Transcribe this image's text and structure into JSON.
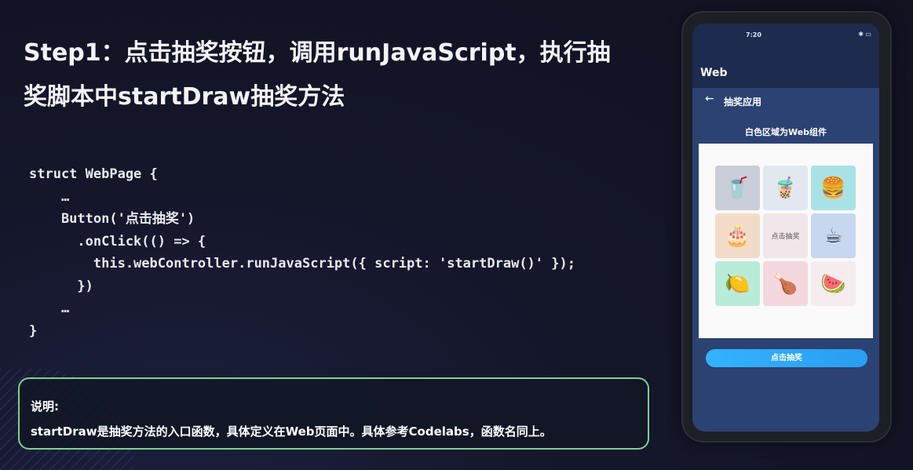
{
  "slide": {
    "title_line1": "Step1：点击抽奖按钮，调用runJavaScript，执行抽",
    "title_line2": "奖脚本中startDraw抽奖方法",
    "code_lines": [
      "struct WebPage {",
      "    …",
      "    Button('点击抽奖')",
      "      .onClick(() => {",
      "        this.webController.runJavaScript({ script: 'startDraw()' });",
      "      })",
      "    …",
      "}"
    ],
    "note_title": "说明:",
    "note_text": "startDraw是抽奖方法的入口函数，具体定义在Web页面中。具体参考Codelabs，函数名同上。"
  },
  "phone": {
    "status_time": "7:20",
    "status_icons": "✱ ▭",
    "app_name": "Web",
    "nav_back_icon": "arrow-left-icon",
    "nav_title": "抽奖应用",
    "subtitle": "白色区域为Web组件",
    "grid": [
      {
        "icon": "🥤",
        "name": "juice-icon",
        "bg": "#c9ced8"
      },
      {
        "icon": "🧋",
        "name": "milk-tea-icon",
        "bg": "#e1e8f0"
      },
      {
        "icon": "🍔",
        "name": "burger-icon",
        "bg": "#a9e2e6"
      },
      {
        "icon": "🎂",
        "name": "cake-icon",
        "bg": "#f2dcc8"
      },
      {
        "label": "点击抽奖",
        "name": "center-draw-cell",
        "bg": "#f1e6ea"
      },
      {
        "icon": "☕",
        "name": "coffee-icon",
        "bg": "#c6d8ef"
      },
      {
        "icon": "🍋",
        "name": "lemon-icon",
        "bg": "#b8ecd8"
      },
      {
        "icon": "🍗",
        "name": "drumstick-icon",
        "bg": "#f3d8df"
      },
      {
        "icon": "🍉",
        "name": "watermelon-icon",
        "bg": "#f4ecef"
      }
    ],
    "draw_button_label": "点击抽奖"
  },
  "colors": {
    "note_border": "#7fd08f",
    "screen_bg": "#2c4273",
    "button": "#33b3ff"
  }
}
